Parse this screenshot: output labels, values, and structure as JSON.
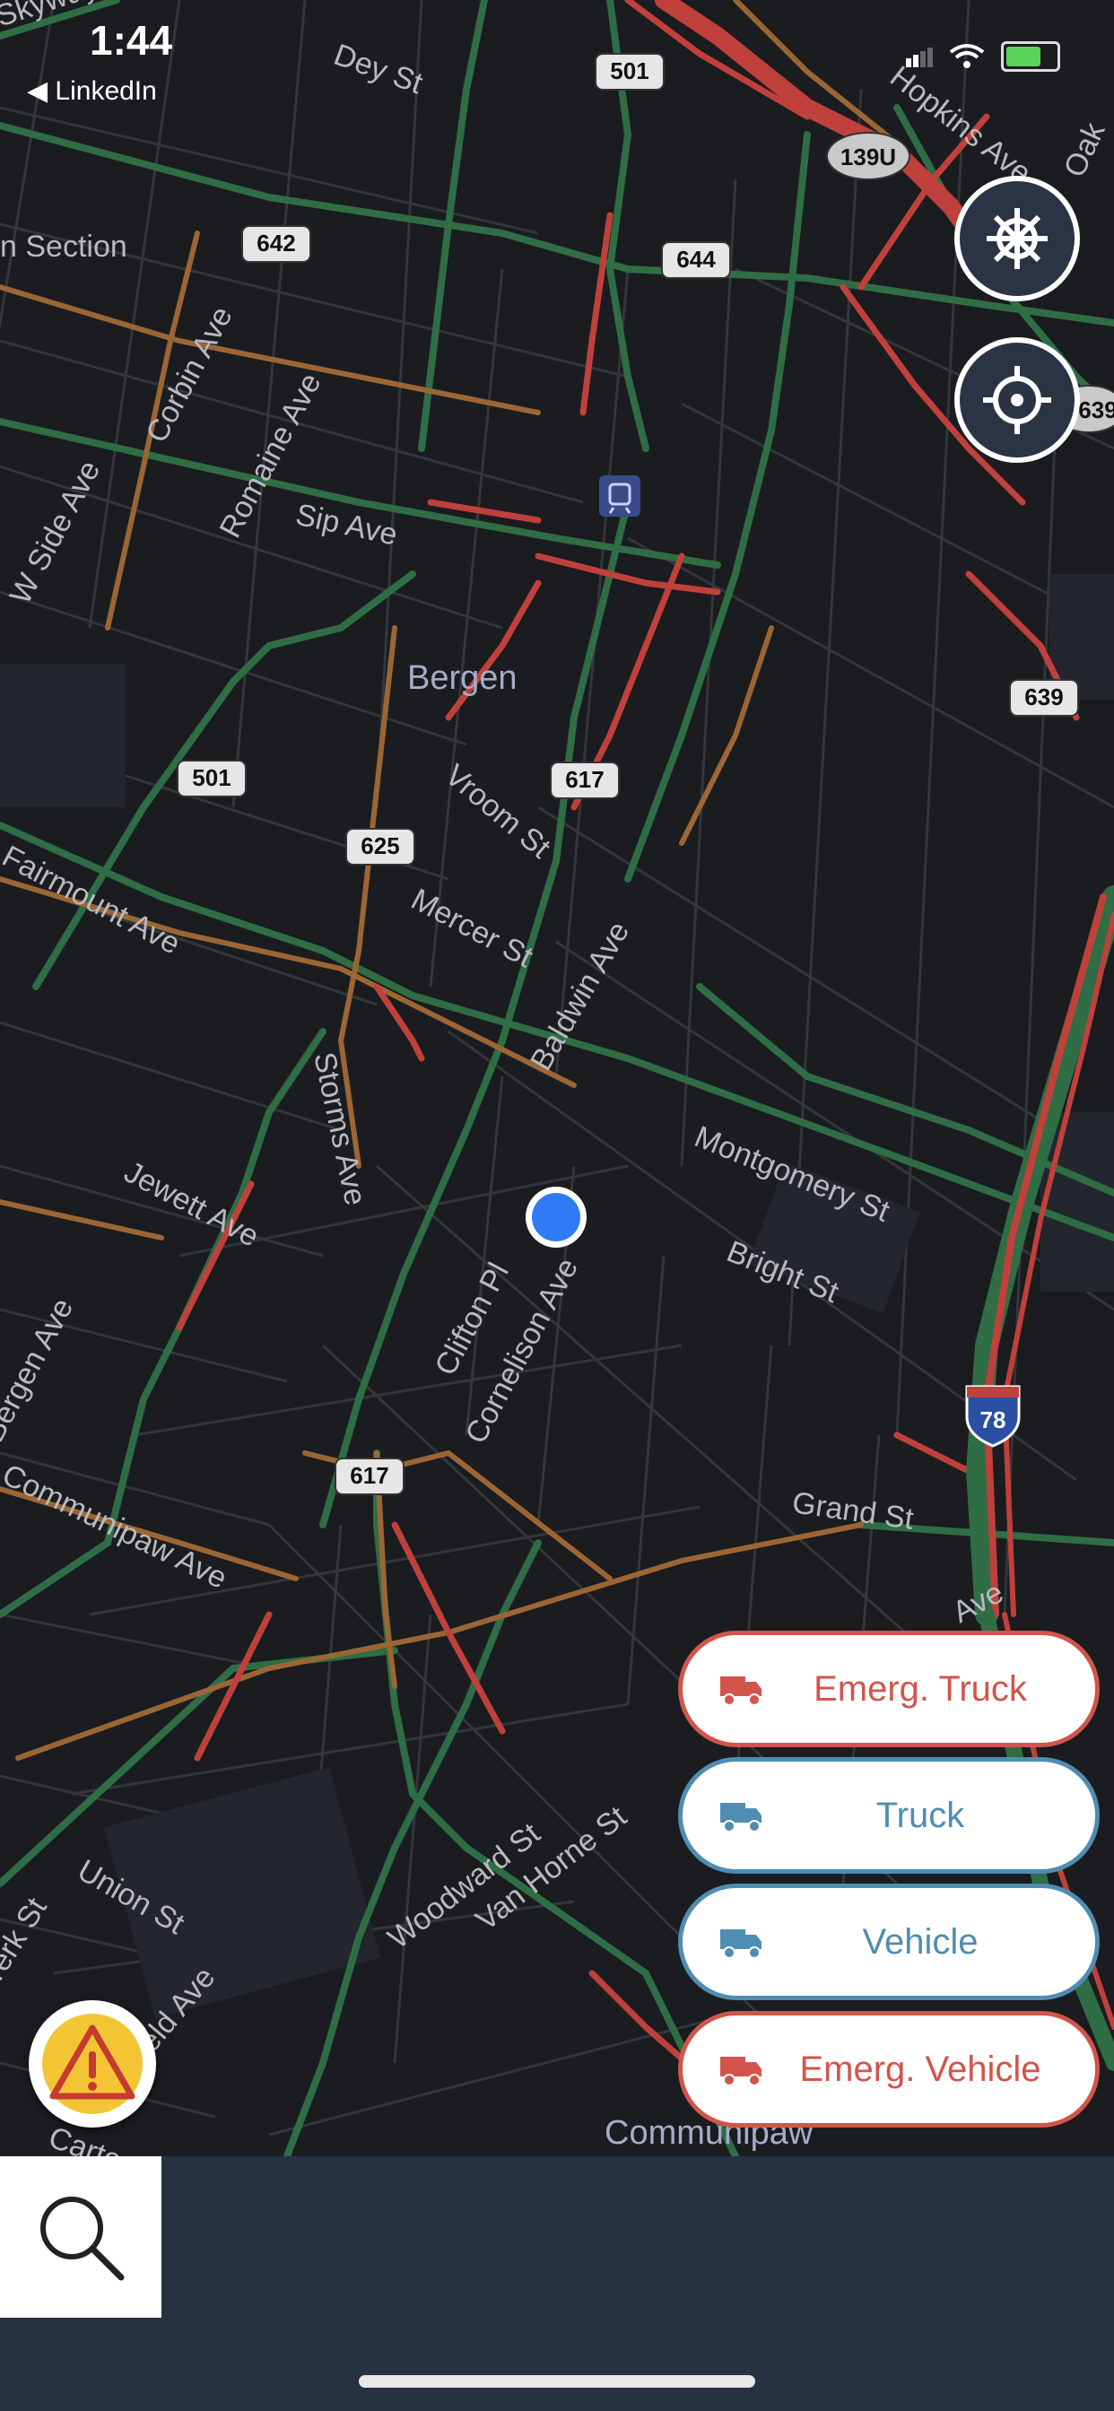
{
  "status_bar": {
    "time": "1:44",
    "back_app": "◀ LinkedIn"
  },
  "map": {
    "street_labels": [
      "Skyway",
      "Dey St",
      "Hopkins Ave",
      "Oak",
      "n Section",
      "Corbin Ave",
      "Romaine Ave",
      "Sip Ave",
      "W Side Ave",
      "Fairmount Ave",
      "Vroom St",
      "Mercer St",
      "Baldwin Ave",
      "Storms Ave",
      "Montgomery St",
      "Bright St",
      "Jewett Ave",
      "Clifton Pl",
      "Cornelison Ave",
      "Bergen Ave",
      "Communipaw Ave",
      "Grand St",
      "Ave",
      "Union St",
      "Woodward St",
      "Van Horne St",
      "rerk St",
      "eld Ave",
      "Carter"
    ],
    "place_labels": [
      "Bergen",
      "Communipaw"
    ],
    "route_shields": [
      "501",
      "139U",
      "642",
      "644",
      "639",
      "639",
      "501",
      "617",
      "625",
      "617"
    ],
    "interstate_shield": "78"
  },
  "controls": {
    "settings_icon": "ship-wheel-icon",
    "locate_icon": "crosshair-icon",
    "alert_icon": "warning-triangle-icon"
  },
  "mode_buttons": [
    {
      "label": "Emerg. Truck",
      "style": "red",
      "icon": "truck-icon"
    },
    {
      "label": "Truck",
      "style": "blue",
      "icon": "truck-icon"
    },
    {
      "label": "Vehicle",
      "style": "blue",
      "icon": "truck-icon"
    },
    {
      "label": "Emerg. Vehicle",
      "style": "red",
      "icon": "truck-icon"
    }
  ],
  "search": {
    "icon": "search-icon",
    "value": ""
  },
  "colors": {
    "emergency": "#d2544a",
    "standard": "#4f8db2",
    "location_dot": "#2f7bf5",
    "panel": "#263142"
  }
}
